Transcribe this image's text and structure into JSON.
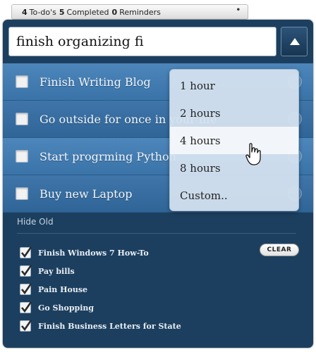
{
  "status": {
    "todo_count": "4",
    "todo_label": "To-do's",
    "completed_count": "5",
    "completed_label": "Completed",
    "reminders_count": "0",
    "reminders_label": "Reminders"
  },
  "input": {
    "value": "finish organizing fi"
  },
  "todos": [
    {
      "label": "Finish Writing Blog"
    },
    {
      "label": "Go outside for once in your life"
    },
    {
      "label": "Start progrming Python"
    },
    {
      "label": "Buy new Laptop"
    }
  ],
  "hide_old_label": "Hide Old",
  "clear_label": "CLEAR",
  "completed": [
    {
      "label": "Finish Windows 7 How-To"
    },
    {
      "label": "Pay bills"
    },
    {
      "label": "Pain House"
    },
    {
      "label": "Go Shopping"
    },
    {
      "label": "Finish Business Letters for State"
    }
  ],
  "reminder_menu": {
    "options": [
      "1 hour",
      "2 hours",
      "4 hours",
      "8 hours",
      "Custom.."
    ],
    "highlighted": "4 hours"
  },
  "colors": {
    "panel": "#1d3f5f",
    "row": "#3f75a9",
    "menu": "#d6e3f0"
  },
  "icons": [
    "chevron-up-icon",
    "clock-icon",
    "checkmark-icon",
    "hand-cursor-icon"
  ]
}
